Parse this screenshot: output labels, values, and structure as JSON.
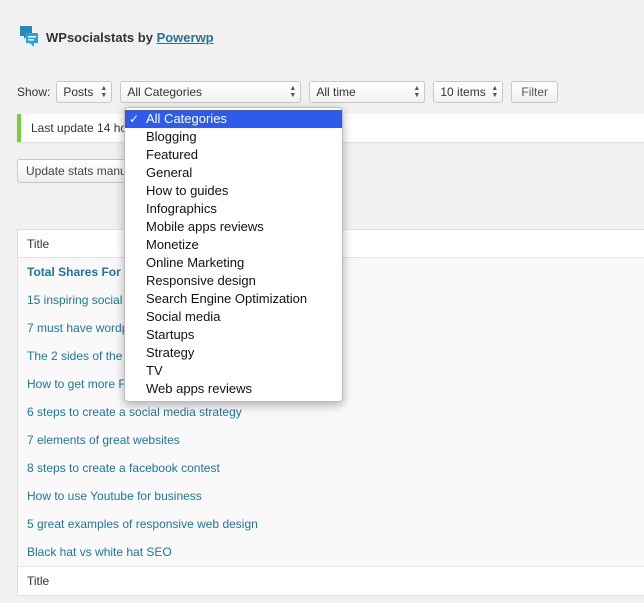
{
  "header": {
    "app_name": "WPsocialstats",
    "by": " by ",
    "author": "Powerwp"
  },
  "filters": {
    "show_label": "Show:",
    "type_value": "Posts",
    "category_value": "All Categories",
    "time_value": "All time",
    "items_value": "10 items",
    "filter_button": "Filter"
  },
  "notice": {
    "text": "Last update 14 ho"
  },
  "update_button": {
    "label": "Update stats manu"
  },
  "dropdown": {
    "selected_check": "✓",
    "options": [
      "All Categories",
      "Blogging",
      "Featured",
      "General",
      "How to guides",
      "Infographics",
      "Mobile apps reviews",
      "Monetize",
      "Online Marketing",
      "Responsive design",
      "Search Engine Optimization",
      "Social media",
      "Startups",
      "Strategy",
      "TV",
      "Web apps reviews"
    ]
  },
  "table": {
    "header": "Title",
    "footer": "Title",
    "rows": [
      "Total Shares For Al",
      "15 inspiring social m",
      "7 must have wordp",
      "The 2 sides of the m",
      "How to get more Fa",
      "6 steps to create a social media strategy",
      "7 elements of great websites",
      "8 steps to create a facebook contest",
      "How to use Youtube for business",
      "5 great examples of responsive web design",
      "Black hat vs white hat SEO"
    ]
  },
  "colors": {
    "link": "#21759b",
    "notice_border": "#7ad03a",
    "selection": "#2f5bea"
  }
}
